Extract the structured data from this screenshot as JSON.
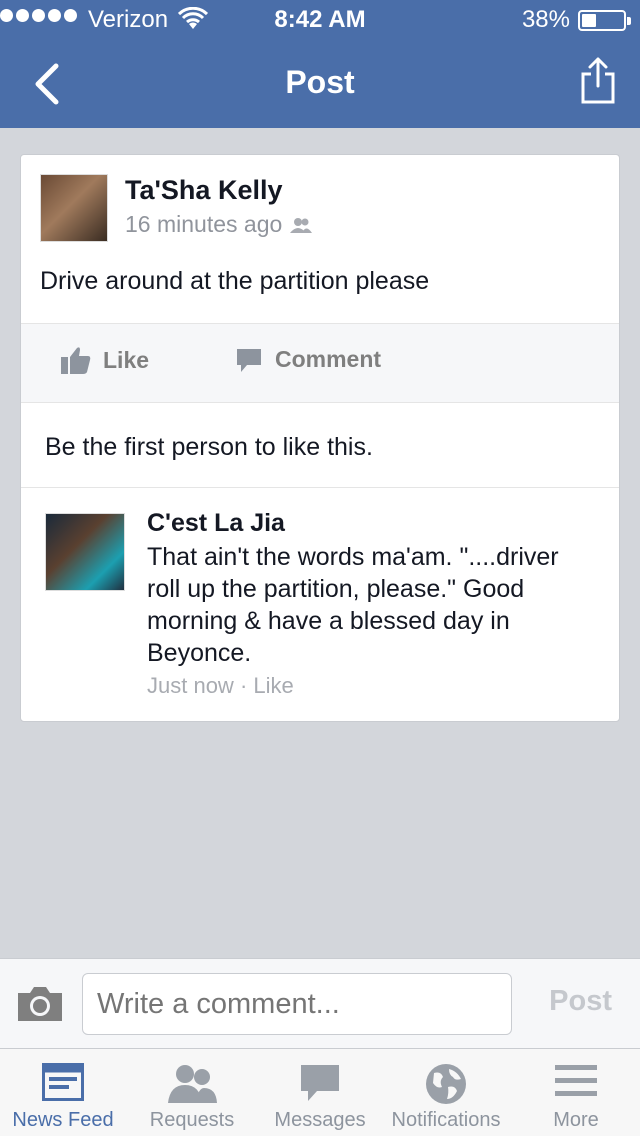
{
  "status_bar": {
    "carrier": "Verizon",
    "time": "8:42 AM",
    "battery": "38%",
    "battery_level": 0.38
  },
  "nav": {
    "title": "Post",
    "back_icon": "chevron-left-icon",
    "share_icon": "share-icon"
  },
  "post": {
    "author": "Ta'Sha Kelly",
    "time_ago": "16 minutes ago",
    "audience_icon": "friends-icon",
    "text": "Drive around at the partition please",
    "actions": {
      "like_label": "Like",
      "comment_label": "Comment"
    },
    "likes_text": "Be the first person to like this."
  },
  "comments": [
    {
      "author": "C'est La Jia",
      "text": "That ain't the words ma'am. \"....driver roll up the partition, please.\" Good morning & have a blessed day in Beyonce.",
      "time": "Just now",
      "separator": "·",
      "like_label": "Like"
    }
  ],
  "composer": {
    "placeholder": "Write a comment...",
    "post_label": "Post",
    "camera_icon": "camera-icon"
  },
  "tabs": [
    {
      "label": "News Feed",
      "icon": "news-feed-icon",
      "active": true
    },
    {
      "label": "Requests",
      "icon": "requests-icon",
      "active": false
    },
    {
      "label": "Messages",
      "icon": "messages-icon",
      "active": false
    },
    {
      "label": "Notifications",
      "icon": "globe-icon",
      "active": false
    },
    {
      "label": "More",
      "icon": "menu-icon",
      "active": false
    }
  ],
  "colors": {
    "brand_blue": "#4a6ea9",
    "tab_active": "#4a6ea9",
    "tab_inactive": "#8d949e"
  }
}
